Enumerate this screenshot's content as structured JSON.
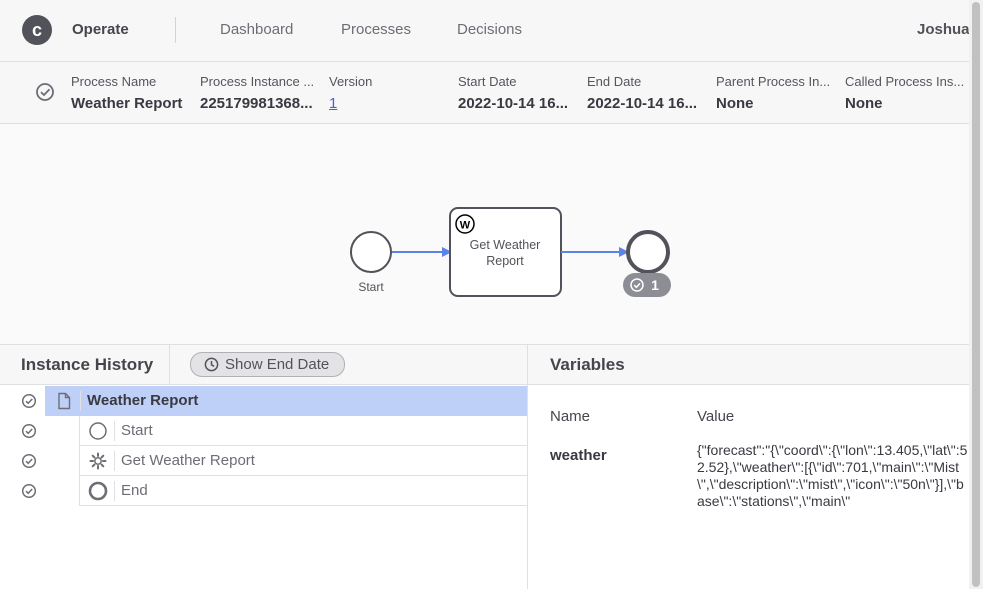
{
  "header": {
    "app_name": "Operate",
    "nav": [
      "Dashboard",
      "Processes",
      "Decisions"
    ],
    "user": "Joshua"
  },
  "instance": {
    "state_icon": "completed-check-icon",
    "columns": [
      {
        "label": "Process Name",
        "value": "Weather Report"
      },
      {
        "label": "Process Instance ...",
        "value": "225179981368..."
      },
      {
        "label": "Version",
        "value": "1"
      },
      {
        "label": "Start Date",
        "value": "2022-10-14 16..."
      },
      {
        "label": "End Date",
        "value": "2022-10-14 16..."
      },
      {
        "label": "Parent Process In...",
        "value": "None"
      },
      {
        "label": "Called Process Ins...",
        "value": "None"
      }
    ]
  },
  "diagram": {
    "start_label": "Start",
    "task_label_line1": "Get Weather",
    "task_label_line2": "Report",
    "task_badge": "W",
    "end_badge_count": "1",
    "flow_color": "#5b84e8"
  },
  "history": {
    "title": "Instance History",
    "toggle_label": "Show End Date",
    "rows": [
      {
        "name": "Weather Report",
        "icon": "document-icon",
        "selected": true
      },
      {
        "name": "Start",
        "icon": "start-event-icon",
        "selected": false
      },
      {
        "name": "Get Weather Report",
        "icon": "gear-icon",
        "selected": false
      },
      {
        "name": "End",
        "icon": "end-event-icon",
        "selected": false
      }
    ]
  },
  "variables": {
    "title": "Variables",
    "name_header": "Name",
    "value_header": "Value",
    "items": [
      {
        "name": "weather",
        "value": "{\"forecast\":\"{\\\"coord\\\":{\\\"lon\\\":13.405,\\\"lat\\\":52.52},\\\"weather\\\":[{\\\"id\\\":701,\\\"main\\\":\\\"Mist\\\",\\\"description\\\":\\\"mist\\\",\\\"icon\\\":\\\"50n\\\"}],\\\"base\\\":\\\"stations\\\",\\\"main\\\""
      }
    ]
  }
}
